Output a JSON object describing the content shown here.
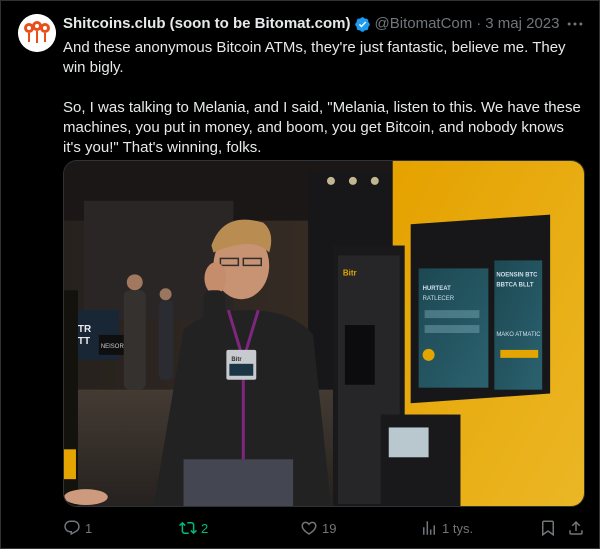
{
  "tweet": {
    "display_name": "Shitcoins.club (soon to be Bitomat.com)",
    "handle": "@BitomatCom",
    "separator": "·",
    "date": "3 maj 2023",
    "paragraphs": [
      "And these anonymous Bitcoin ATMs, they're just fantastic, believe me. They win bigly.",
      "So, I was talking to Melania, and I said, \"Melania, listen to this. We have these machines, you put in money, and boom, you get Bitcoin, and nobody knows it's you!\" That's winning, folks."
    ],
    "media": {
      "atm_screen_text": [
        "NOENSIN BTC",
        "BBTCA BLLT",
        "MAKO ATMATIC"
      ],
      "atm_side_text": [
        "HURTEAT",
        "RATLECER"
      ],
      "atm_brand": "Bitr",
      "badge_text": "Bitr",
      "booth_sign": [
        "TR",
        "TT"
      ],
      "booth_brand": "NEISOR"
    },
    "actions": {
      "replies": "1",
      "retweets": "2",
      "likes": "19",
      "views": "1 tys."
    }
  },
  "colors": {
    "background": "#000000",
    "text": "#e7e9ea",
    "muted": "#71767b",
    "verified": "#1d9bf0",
    "retweet_active": "#00ba7c",
    "border": "#2f3336"
  },
  "icons": [
    "avatar-logo",
    "verified-badge-icon",
    "more-icon",
    "reply-icon",
    "retweet-icon",
    "like-icon",
    "views-icon",
    "bookmark-icon",
    "share-icon"
  ]
}
